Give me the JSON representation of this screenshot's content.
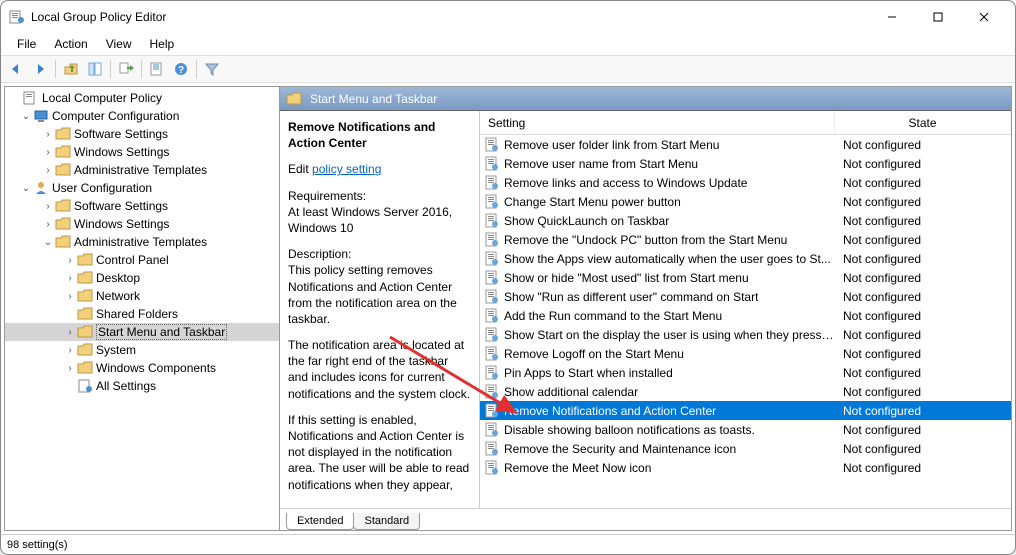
{
  "window": {
    "title": "Local Group Policy Editor"
  },
  "menubar": [
    "File",
    "Action",
    "View",
    "Help"
  ],
  "tree": {
    "root": "Local Computer Policy",
    "computer_config": "Computer Configuration",
    "user_config": "User Configuration",
    "software_settings": "Software Settings",
    "windows_settings": "Windows Settings",
    "admin_templates": "Administrative Templates",
    "control_panel": "Control Panel",
    "desktop": "Desktop",
    "network": "Network",
    "shared_folders": "Shared Folders",
    "start_menu": "Start Menu and Taskbar",
    "system": "System",
    "windows_components": "Windows Components",
    "all_settings": "All Settings"
  },
  "right_header": "Start Menu and Taskbar",
  "desc": {
    "title": "Remove Notifications and Action Center",
    "edit_prefix": "Edit ",
    "edit_link": "policy setting",
    "requirements_label": "Requirements:",
    "requirements": "At least Windows Server 2016, Windows 10",
    "description_label": "Description:",
    "description_p1": "This policy setting removes Notifications and Action Center from the notification area on the taskbar.",
    "description_p2": "The notification area is located at the far right end of the taskbar and includes icons for current notifications and the system clock.",
    "description_p3": "If this setting is enabled, Notifications and Action Center is not displayed in the notification area. The user will be able to read notifications when they appear,"
  },
  "list": {
    "col_setting": "Setting",
    "col_state": "State",
    "rows": [
      {
        "name": "Remove user folder link from Start Menu",
        "state": "Not configured"
      },
      {
        "name": "Remove user name from Start Menu",
        "state": "Not configured"
      },
      {
        "name": "Remove links and access to Windows Update",
        "state": "Not configured"
      },
      {
        "name": "Change Start Menu power button",
        "state": "Not configured"
      },
      {
        "name": "Show QuickLaunch on Taskbar",
        "state": "Not configured"
      },
      {
        "name": "Remove the \"Undock PC\" button from the Start Menu",
        "state": "Not configured"
      },
      {
        "name": "Show the Apps view automatically when the user goes to St...",
        "state": "Not configured"
      },
      {
        "name": "Show or hide \"Most used\" list from Start menu",
        "state": "Not configured"
      },
      {
        "name": "Show \"Run as different user\" command on Start",
        "state": "Not configured"
      },
      {
        "name": "Add the Run command to the Start Menu",
        "state": "Not configured"
      },
      {
        "name": "Show Start on the display the user is using when they press t...",
        "state": "Not configured"
      },
      {
        "name": "Remove Logoff on the Start Menu",
        "state": "Not configured"
      },
      {
        "name": "Pin Apps to Start when installed",
        "state": "Not configured"
      },
      {
        "name": "Show additional calendar",
        "state": "Not configured"
      },
      {
        "name": "Remove Notifications and Action Center",
        "state": "Not configured",
        "selected": true
      },
      {
        "name": "Disable showing balloon notifications as toasts.",
        "state": "Not configured"
      },
      {
        "name": "Remove the Security and Maintenance icon",
        "state": "Not configured"
      },
      {
        "name": "Remove the Meet Now icon",
        "state": "Not configured"
      }
    ]
  },
  "tabs": {
    "extended": "Extended",
    "standard": "Standard"
  },
  "statusbar": "98 setting(s)"
}
